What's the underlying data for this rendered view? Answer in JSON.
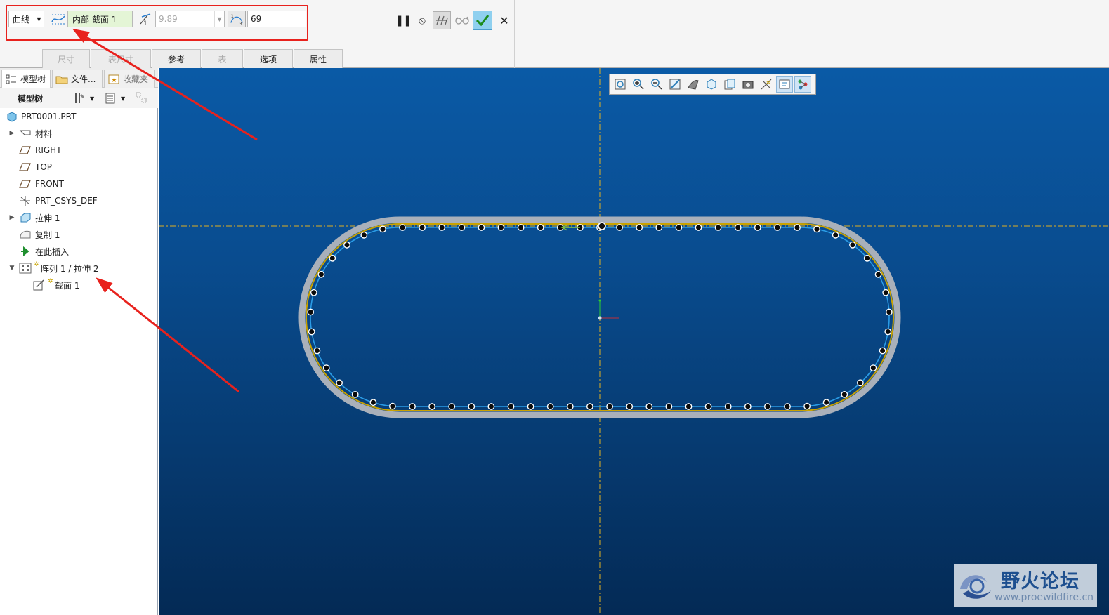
{
  "ribbon": {
    "type_select": "曲线",
    "section_field": "内部 截面 1",
    "spacing_field": "9.89",
    "count_field": "69",
    "tabs": [
      {
        "label": "尺寸",
        "enabled": false
      },
      {
        "label": "表尺寸",
        "enabled": false
      },
      {
        "label": "参考",
        "enabled": true
      },
      {
        "label": "表",
        "enabled": false
      },
      {
        "label": "选项",
        "enabled": true
      },
      {
        "label": "属性",
        "enabled": true
      }
    ]
  },
  "panel": {
    "tabs": [
      "模型树",
      "文件...",
      "收藏夹"
    ],
    "toolbar_label": "模型树"
  },
  "tree": {
    "root": "PRT0001.PRT",
    "items": [
      {
        "label": "材料"
      },
      {
        "label": "RIGHT"
      },
      {
        "label": "TOP"
      },
      {
        "label": "FRONT"
      },
      {
        "label": "PRT_CSYS_DEF"
      },
      {
        "label": "拉伸 1"
      },
      {
        "label": "复制 1"
      },
      {
        "label": "在此插入"
      },
      {
        "label": "阵列 1 / 拉伸 2"
      },
      {
        "label": "截面 1"
      }
    ]
  },
  "watermark": {
    "title": "野火论坛",
    "url": "www.proewildfire.cn"
  },
  "colors": {
    "annotation": "#e8221d",
    "ok_button": "#8fd0ef",
    "section_field_bg": "#e4f5d6"
  }
}
